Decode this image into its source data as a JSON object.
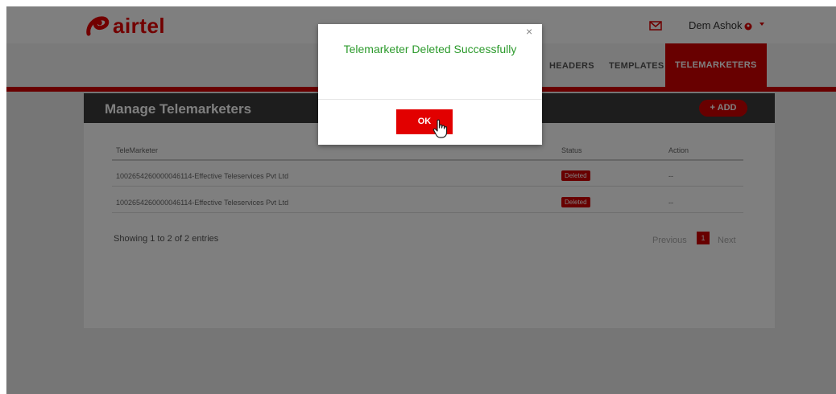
{
  "brand": {
    "name": "airtel"
  },
  "header": {
    "user_name": "Dem Ashok"
  },
  "nav": {
    "items": [
      "HEADERS",
      "TEMPLATES",
      "TELEMARKETERS"
    ],
    "active": "TELEMARKETERS"
  },
  "panel": {
    "title": "Manage Telemarketers",
    "add_label": "+ ADD"
  },
  "table": {
    "columns": [
      "TeleMarketer",
      "Status",
      "Action"
    ],
    "rows": [
      {
        "telemarketer": "1002654260000046114-Effective Teleservices Pvt Ltd",
        "status": "Deleted",
        "action": "--"
      },
      {
        "telemarketer": "1002654260000046114-Effective Teleservices Pvt Ltd",
        "status": "Deleted",
        "action": "--"
      }
    ]
  },
  "footer": {
    "showing": "Showing 1 to 2 of 2 entries",
    "previous": "Previous",
    "page": "1",
    "next": "Next"
  },
  "modal": {
    "close": "×",
    "message": "Telemarketer Deleted Successfully",
    "ok_label": "OK"
  },
  "icons": {
    "mail": "mail-icon",
    "user": "user-circle-icon",
    "caret": "caret-down-icon",
    "close": "close-icon",
    "cursor": "hand-pointer-icon"
  },
  "colors": {
    "brand_red": "#d10000",
    "success_green": "#2c9a2c"
  }
}
